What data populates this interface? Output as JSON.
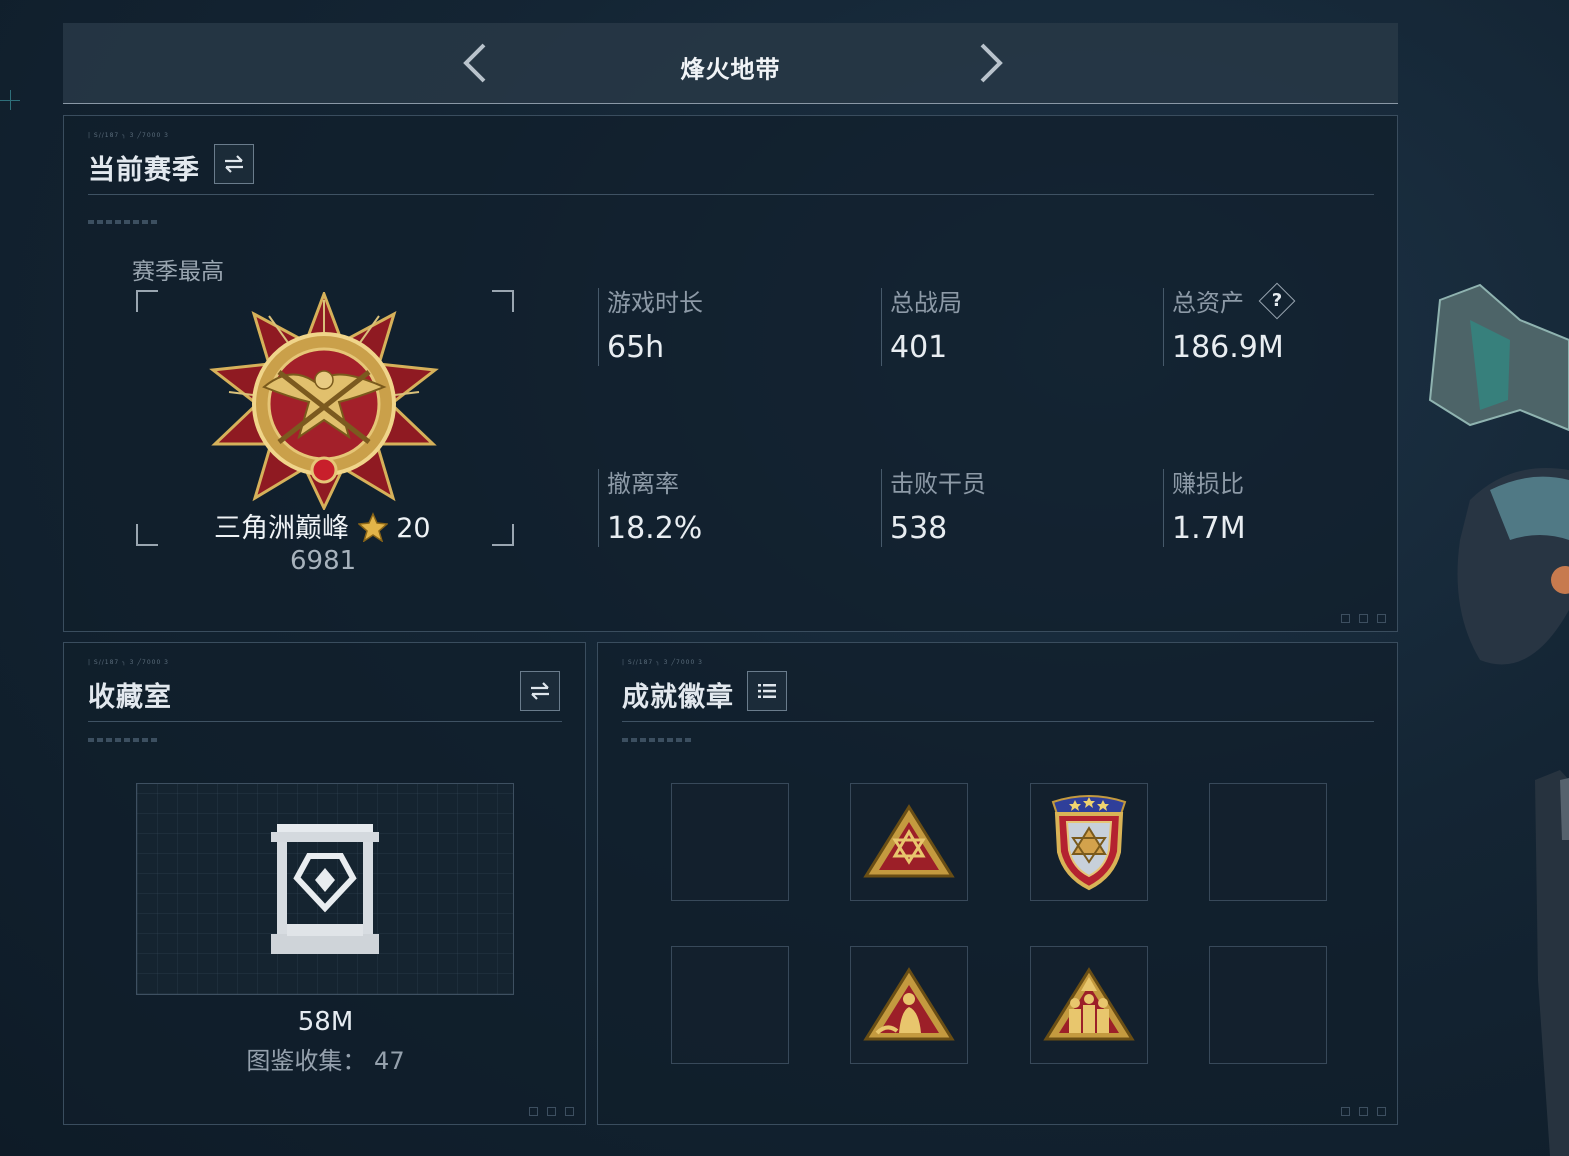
{
  "header": {
    "title": "烽火地带"
  },
  "season": {
    "title": "当前赛季",
    "highest_label": "赛季最高",
    "rank_name": "三角洲巅峰",
    "rank_stars": "20",
    "rank_score": "6981",
    "stats": [
      {
        "label": "游戏时长",
        "value": "65h"
      },
      {
        "label": "总战局",
        "value": "401"
      },
      {
        "label": "总资产",
        "value": "186.9M"
      },
      {
        "label": "撤离率",
        "value": "18.2%"
      },
      {
        "label": "击败干员",
        "value": "538"
      },
      {
        "label": "赚损比",
        "value": "1.7M"
      }
    ],
    "help_glyph": "?"
  },
  "collection": {
    "title": "收藏室",
    "value": "58M",
    "count_label": "图鉴收集：",
    "count_value": "47"
  },
  "achievements": {
    "title": "成就徽章",
    "slots": [
      "empty",
      "triangle-badge",
      "shield-badge",
      "empty",
      "empty",
      "triangle-figure-badge",
      "triangle-group-badge",
      "empty"
    ]
  },
  "colors": {
    "gold": "#c9a24a",
    "red": "#a3202a",
    "panel_border": "#3a4d5e"
  }
}
